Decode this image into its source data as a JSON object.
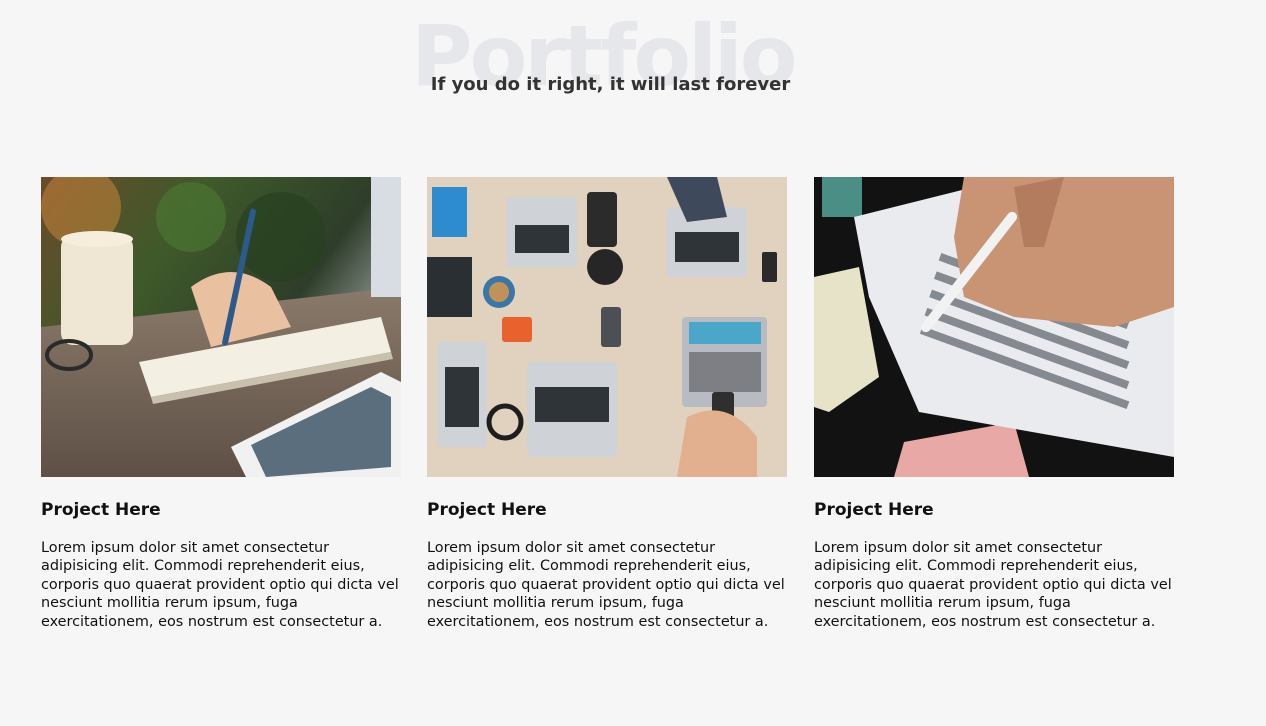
{
  "portfolio": {
    "background_title": "Portfolio",
    "subtitle": "If you do it right, it will last forever",
    "projects": [
      {
        "title": "Project Here",
        "description": "Lorem ipsum dolor sit amet consectetur adipisicing elit. Commodi reprehenderit eius, corporis quo quaerat provident optio qui dicta vel nesciunt mollitia rerum ipsum, fuga exercitationem, eos nostrum est consectetur a.",
        "image": "notebook-writing-photo"
      },
      {
        "title": "Project Here",
        "description": "Lorem ipsum dolor sit amet consectetur adipisicing elit. Commodi reprehenderit eius, corporis quo quaerat provident optio qui dicta vel nesciunt mollitia rerum ipsum, fuga exercitationem, eos nostrum est consectetur a.",
        "image": "team-laptops-desk-photo"
      },
      {
        "title": "Project Here",
        "description": "Lorem ipsum dolor sit amet consectetur adipisicing elit. Commodi reprehenderit eius, corporis quo quaerat provident optio qui dicta vel nesciunt mollitia rerum ipsum, fuga exercitationem, eos nostrum est consectetur a.",
        "image": "answer-sheet-pencil-photo"
      }
    ]
  },
  "colors": {
    "page_background": "#f6f6f6",
    "background_title": "#e6e7ea",
    "subtitle": "#333333",
    "text": "#111111"
  }
}
